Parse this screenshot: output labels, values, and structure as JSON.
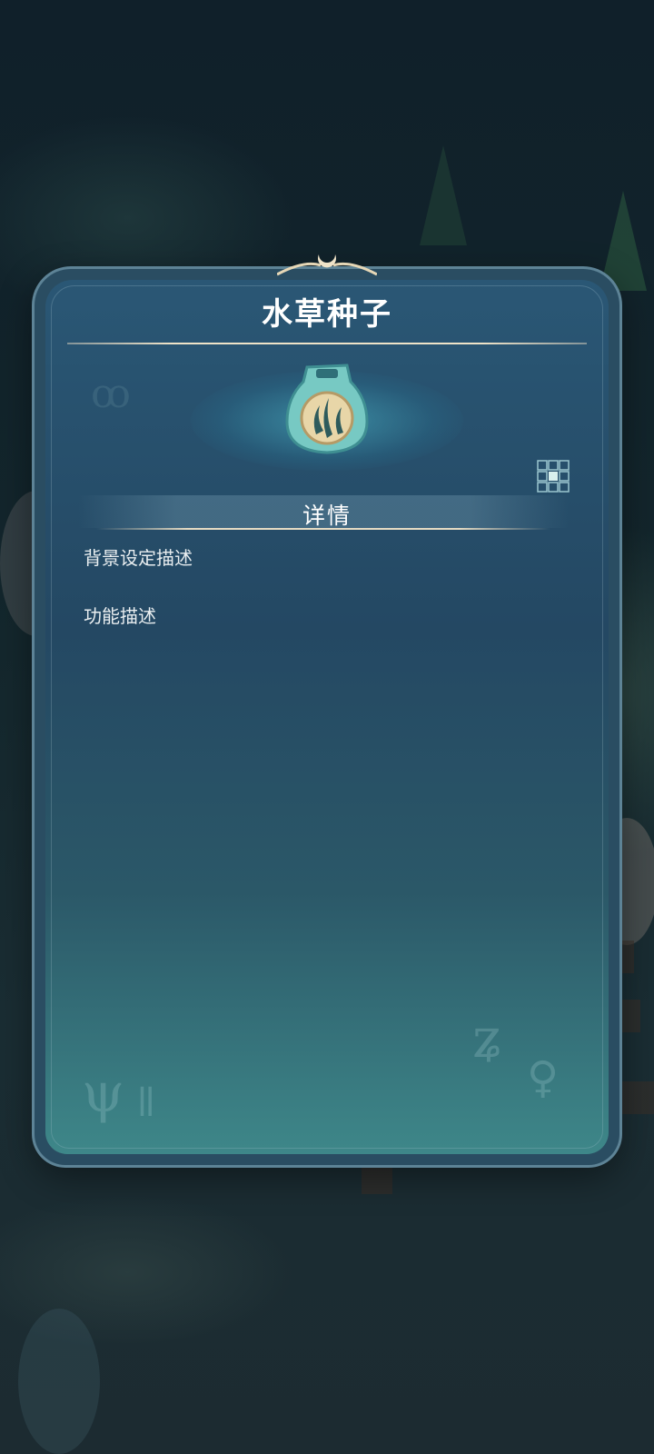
{
  "item": {
    "name": "水草种子",
    "icon": "seed-pouch-icon"
  },
  "details": {
    "heading": "详情",
    "background_label": "背景设定描述",
    "function_label": "功能描述"
  },
  "controls": {
    "grid_icon": "grid-view-icon"
  },
  "colors": {
    "panel": "#244863",
    "panel_border": "#5d8396",
    "accent_gold": "#efe3c8"
  }
}
